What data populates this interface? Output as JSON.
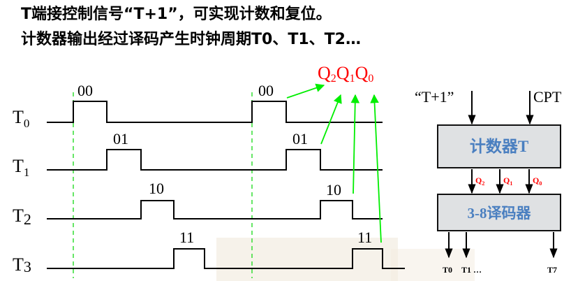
{
  "heading": {
    "line1": "T端接控制信号“T+1”，可实现计数和复位。",
    "line2": "计数器输出经过译码产生时钟周期T0、T1、T2…"
  },
  "timing": {
    "rows": [
      {
        "label": "T",
        "sub": "0",
        "codes": [
          "00",
          "00"
        ]
      },
      {
        "label": "T",
        "sub": "1",
        "codes": [
          "01",
          "01"
        ]
      },
      {
        "label": "T",
        "sub": "2",
        "codes": [
          "10",
          "10"
        ]
      },
      {
        "label": "T",
        "sub": "3",
        "codes": [
          "11",
          "11"
        ]
      }
    ],
    "q_label": {
      "q2": "Q",
      "q2_sub": "2",
      "q1": "Q",
      "q1_sub": "1",
      "q0": "Q",
      "q0_sub": "0"
    }
  },
  "block": {
    "input_t1": "“T+1”",
    "input_cpt": "CPT",
    "counter": "计数器T",
    "q2": "Q",
    "q2_sub": "2",
    "q1": "Q",
    "q1_sub": "1",
    "q0": "Q",
    "q0_sub": "0",
    "decoder": "3-8译码器",
    "out_t0": "T0",
    "out_t1": "T1 …",
    "out_t7": "T7"
  },
  "colors": {
    "signal": "#000000",
    "green_arrow": "#00ee00",
    "dashed_guide": "#33dd33",
    "q_red": "#ff0000",
    "block_fill": "#dfe1e3",
    "block_text": "#4a7fc0"
  }
}
